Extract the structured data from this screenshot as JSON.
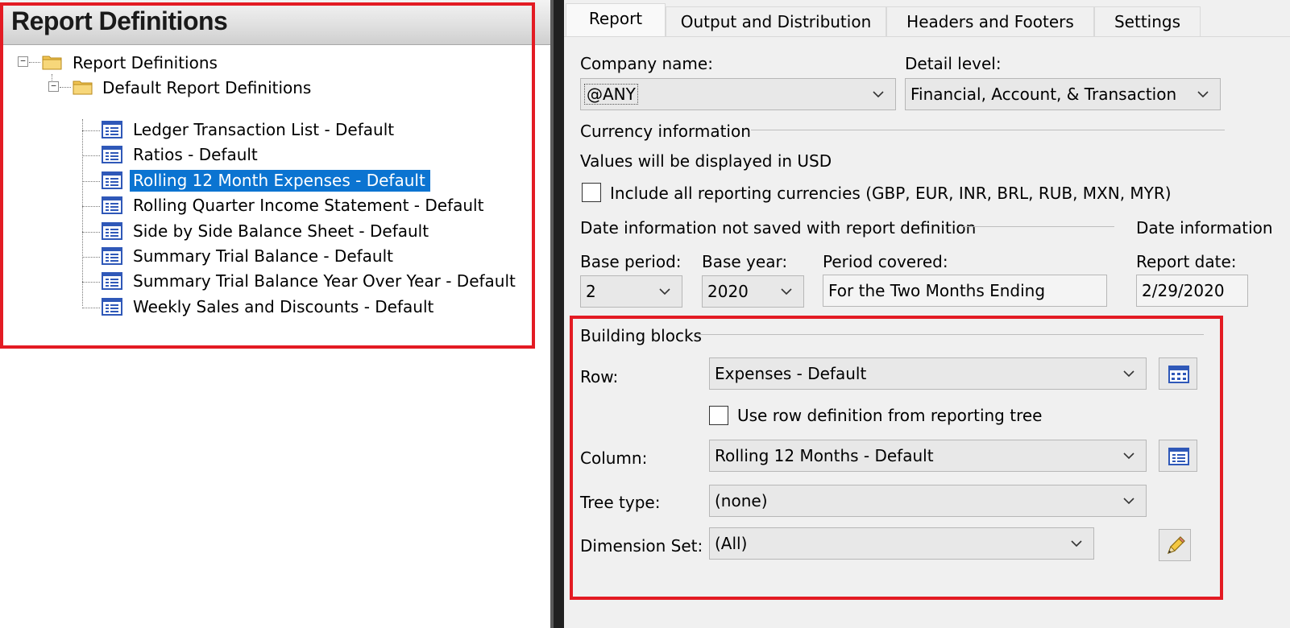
{
  "left_panel": {
    "title": "Report Definitions",
    "tree": {
      "root_label": "Report Definitions",
      "root_toggle": "−",
      "folder_label": "Default Report Definitions",
      "folder_toggle": "−",
      "items": [
        {
          "label": "Ledger Transaction List - Default"
        },
        {
          "label": "Ratios - Default"
        },
        {
          "label": "Rolling 12 Month Expenses - Default",
          "selected": true
        },
        {
          "label": "Rolling Quarter Income Statement - Default"
        },
        {
          "label": "Side by Side Balance Sheet - Default"
        },
        {
          "label": "Summary Trial Balance - Default"
        },
        {
          "label": "Summary Trial Balance Year Over Year - Default"
        },
        {
          "label": "Weekly Sales and Discounts - Default"
        }
      ]
    }
  },
  "tabs": [
    {
      "label": "Report",
      "active": true
    },
    {
      "label": "Output and Distribution"
    },
    {
      "label": "Headers and Footers"
    },
    {
      "label": "Settings"
    }
  ],
  "report_tab": {
    "company_name": {
      "label": "Company name:",
      "value": "@ANY"
    },
    "detail_level": {
      "label": "Detail level:",
      "value": "Financial, Account, & Transaction"
    },
    "currency": {
      "section_title": "Currency information",
      "display_text": "Values will be displayed in USD",
      "include_all_label": "Include all reporting currencies (GBP, EUR, INR, BRL, RUB, MXN, MYR)",
      "include_all_checked": false
    },
    "date_info": {
      "section_title": "Date information not saved with report definition",
      "section_title_right": "Date information",
      "base_period": {
        "label": "Base period:",
        "value": "2"
      },
      "base_year": {
        "label": "Base year:",
        "value": "2020"
      },
      "period_covered": {
        "label": "Period covered:",
        "value": "For the Two Months Ending"
      },
      "report_date": {
        "label": "Report date:",
        "value": "2/29/2020"
      }
    },
    "building_blocks": {
      "section_title": "Building blocks",
      "row": {
        "label": "Row:",
        "value": "Expenses - Default"
      },
      "use_row_from_tree": {
        "label": "Use row definition from reporting tree",
        "checked": false
      },
      "column": {
        "label": "Column:",
        "value": "Rolling 12 Months - Default"
      },
      "tree_type": {
        "label": "Tree type:",
        "value": "(none)"
      },
      "dimension_set": {
        "label": "Dimension Set:",
        "value": "(All)"
      }
    }
  },
  "colors": {
    "highlight_red": "#e31b23",
    "selection_blue": "#0b74d1",
    "panel_gray": "#f0f0f0"
  },
  "icons": [
    "folder-icon",
    "report-document-icon",
    "chevron-down-icon",
    "row-grid-icon",
    "column-grid-icon",
    "pencil-edit-icon"
  ]
}
